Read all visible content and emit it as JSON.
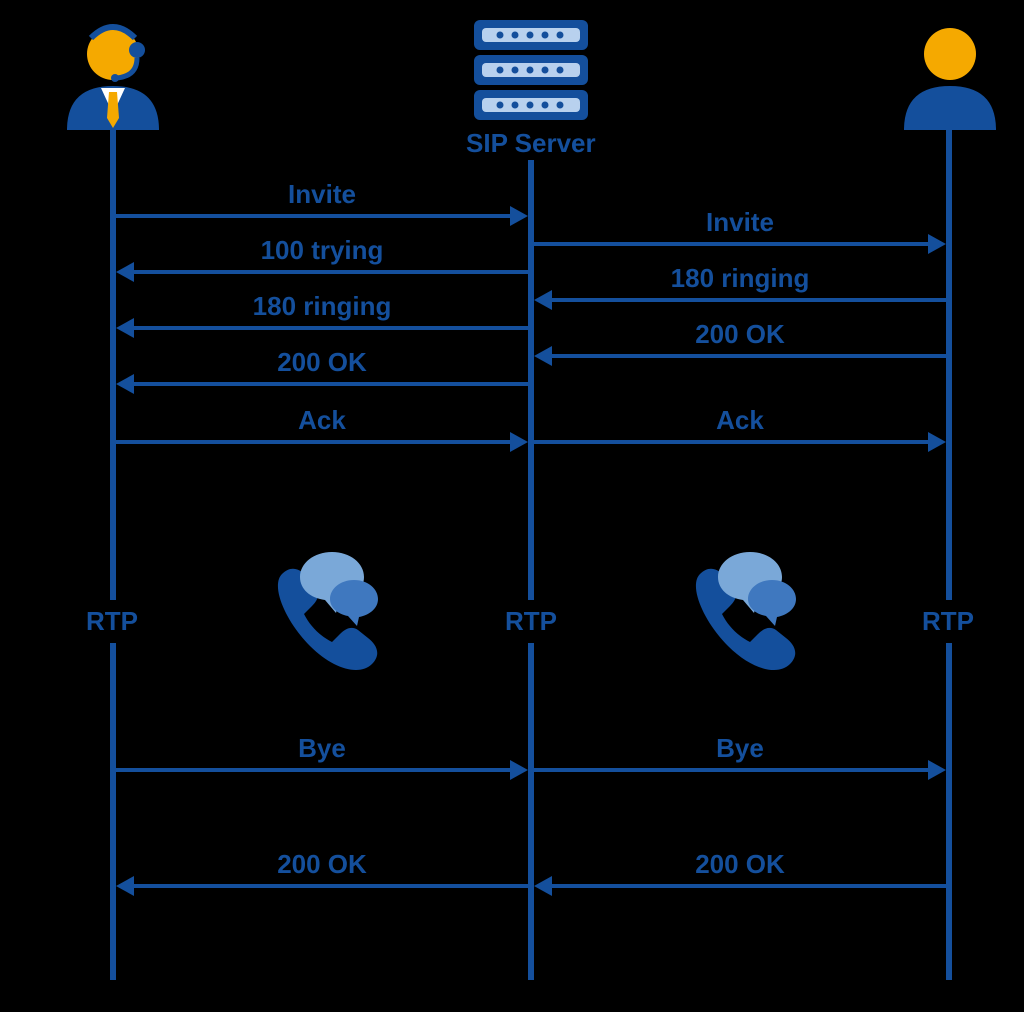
{
  "server_label": "SIP Server",
  "rtp": "RTP",
  "messages": {
    "left": {
      "invite": "Invite",
      "trying": "100 trying",
      "ringing": "180 ringing",
      "ok1": "200 OK",
      "ack": "Ack",
      "bye": "Bye",
      "ok2": "200 OK"
    },
    "right": {
      "invite": "Invite",
      "ringing": "180 ringing",
      "ok1": "200 OK",
      "ack": "Ack",
      "bye": "Bye",
      "ok2": "200 OK"
    }
  },
  "actors": {
    "caller": "operator-with-headset",
    "server": "sip-server",
    "callee": "person"
  },
  "colors": {
    "primary": "#144f9c",
    "accent": "#f5a900",
    "light": "#b8d1ee"
  }
}
